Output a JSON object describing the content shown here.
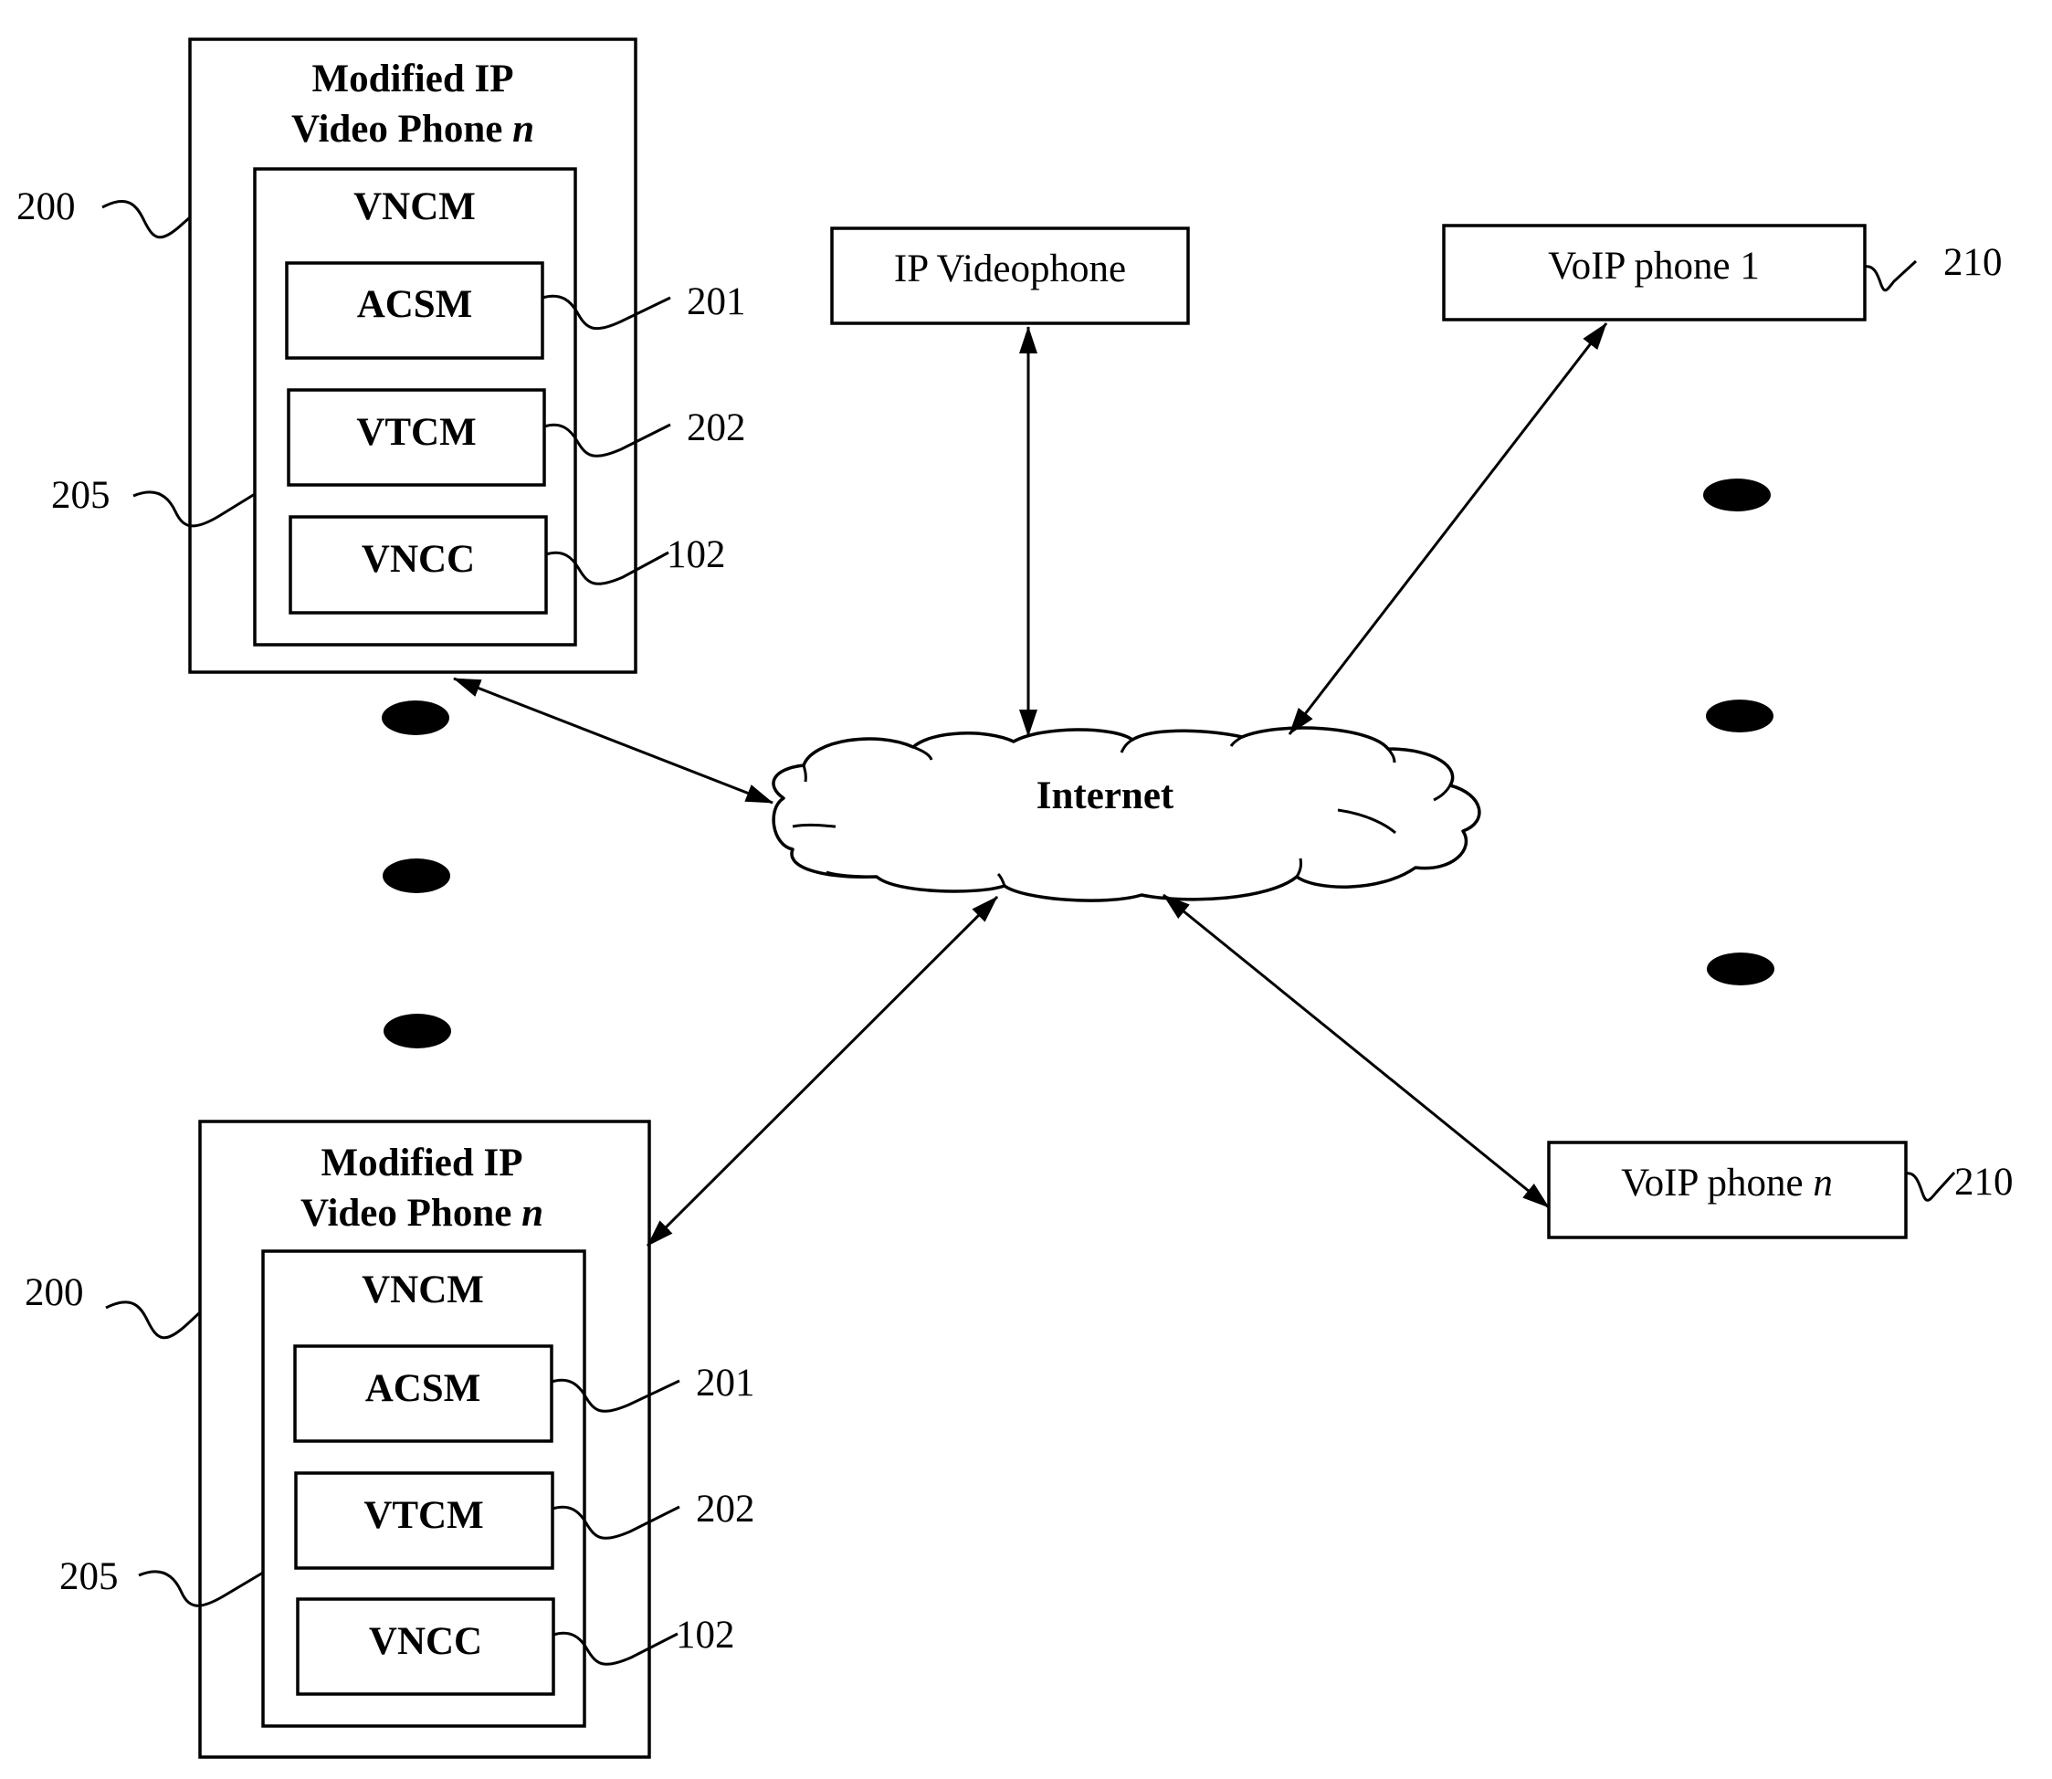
{
  "diagram": {
    "modified_phones": [
      {
        "title_line1": "Modified IP",
        "title_line2": "Video Phone",
        "title_var": "n",
        "ref_phone": "200",
        "ref_module": "205",
        "module_label": "VNCM",
        "submodules": [
          {
            "label": "ACSM",
            "ref": "201"
          },
          {
            "label": "VTCM",
            "ref": "202"
          },
          {
            "label": "VNCC",
            "ref": "102"
          }
        ]
      },
      {
        "title_line1": "Modified IP",
        "title_line2": "Video Phone",
        "title_var": "n",
        "ref_phone": "200",
        "ref_module": "205",
        "module_label": "VNCM",
        "submodules": [
          {
            "label": "ACSM",
            "ref": "201"
          },
          {
            "label": "VTCM",
            "ref": "202"
          },
          {
            "label": "VNCC",
            "ref": "102"
          }
        ]
      }
    ],
    "network": {
      "label": "Internet"
    },
    "ip_videophone": {
      "label": "IP Videophone"
    },
    "voip_phones": [
      {
        "label": "VoIP phone",
        "var": "1",
        "var_italic": false,
        "ref": "210"
      },
      {
        "label": "VoIP phone",
        "var": "n",
        "var_italic": true,
        "ref": "210"
      }
    ],
    "connections": [
      {
        "from": "Modified IP Video Phone n (top)",
        "to": "Internet",
        "type": "bidirectional"
      },
      {
        "from": "Modified IP Video Phone n (bottom)",
        "to": "Internet",
        "type": "bidirectional"
      },
      {
        "from": "IP Videophone",
        "to": "Internet",
        "type": "bidirectional"
      },
      {
        "from": "VoIP phone 1",
        "to": "Internet",
        "type": "bidirectional"
      },
      {
        "from": "VoIP phone n",
        "to": "Internet",
        "type": "bidirectional"
      }
    ],
    "ellipsis": {
      "left_dots": 3,
      "right_dots": 3
    }
  }
}
